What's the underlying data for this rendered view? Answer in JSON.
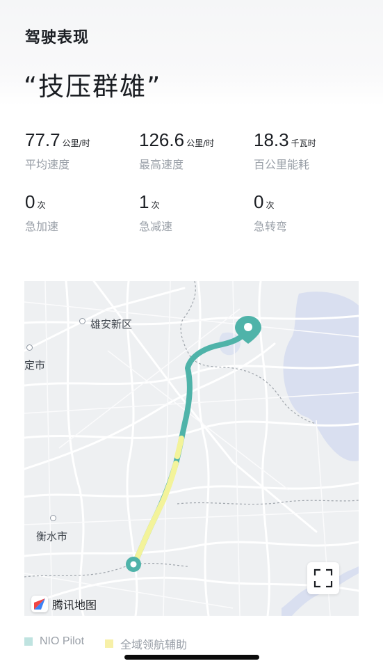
{
  "header": {
    "title": "驾驶表现"
  },
  "headline": "“技压群雄”",
  "stats": [
    {
      "value": "77.7",
      "unit": "公里/时",
      "label": "平均速度"
    },
    {
      "value": "126.6",
      "unit": "公里/时",
      "label": "最高速度"
    },
    {
      "value": "18.3",
      "unit": "千瓦时",
      "label": "百公里能耗"
    },
    {
      "value": "0",
      "unit": "次",
      "label": "急加速"
    },
    {
      "value": "1",
      "unit": "次",
      "label": "急减速"
    },
    {
      "value": "0",
      "unit": "次",
      "label": "急转弯"
    }
  ],
  "map": {
    "cities": [
      "雄安新区",
      "定市",
      "衡水市"
    ],
    "provider": "腾讯地图",
    "expand_icon": "fullscreen-icon",
    "route_colors": {
      "nio_pilot": "#4fb3a9",
      "full_domain": "#f3f39a"
    }
  },
  "legend": [
    {
      "label": "NIO Pilot",
      "color": "#bfe3e0"
    },
    {
      "label": "全域领航辅助",
      "color": "#f7f0a8"
    }
  ]
}
